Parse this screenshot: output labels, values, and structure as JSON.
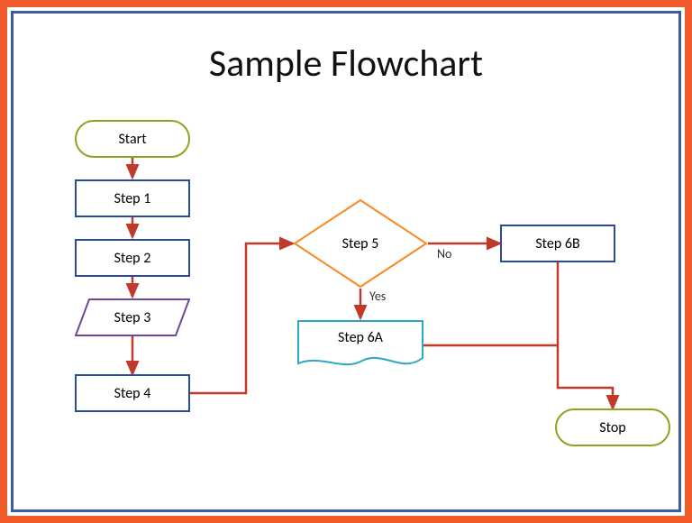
{
  "title": "Sample Flowchart",
  "nodes": {
    "start": "Start",
    "step1": "Step 1",
    "step2": "Step 2",
    "step3": "Step 3",
    "step4": "Step 4",
    "step5": "Step 5",
    "step6a": "Step 6A",
    "step6b": "Step 6B",
    "stop": "Stop"
  },
  "edges": {
    "no": "No",
    "yes": "Yes"
  },
  "colors": {
    "outer_border": "#f05a28",
    "inner_border": "#3b5ba5",
    "terminator": "#8fa31e",
    "process": "#2a4b9b",
    "decision": "#f68b1e",
    "data_shape": "#6b4a9a",
    "document": "#2aa7c9",
    "connector": "#c0392b"
  }
}
